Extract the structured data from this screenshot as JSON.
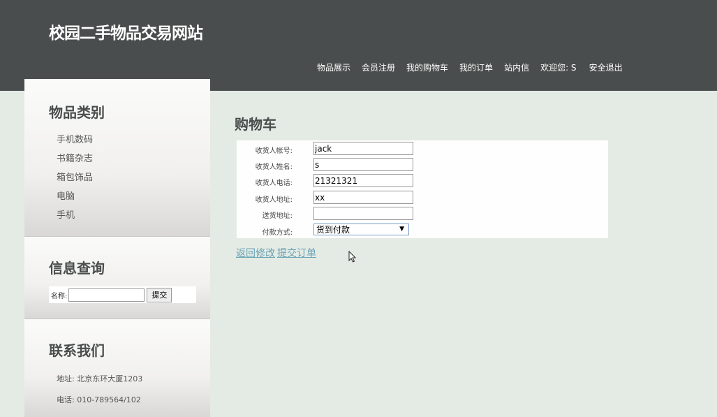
{
  "header": {
    "title": "校园二手物品交易网站",
    "nav": [
      "物品展示",
      "会员注册",
      "我的购物车",
      "我的订单",
      "站内信"
    ],
    "welcome": "欢迎您: S",
    "logout": "安全退出"
  },
  "sidebar": {
    "categories": {
      "heading": "物品类别",
      "items": [
        "手机数码",
        "书籍杂志",
        "箱包饰品",
        "电脑",
        "手机"
      ]
    },
    "search": {
      "heading": "信息查询",
      "label": "名称:",
      "value": "",
      "button": "提交"
    },
    "contact": {
      "heading": "联系我们",
      "address": "地址: 北京东环大厦1203",
      "phone": "电话: 010-789564/102"
    }
  },
  "main": {
    "title": "购物车",
    "form": {
      "account_label": "收货人帐号:",
      "account_value": "jack",
      "name_label": "收货人姓名:",
      "name_value": "s",
      "phone_label": "收货人电话:",
      "phone_value": "21321321",
      "address_label": "收货人地址:",
      "address_value": "xx",
      "delivery_label": "送货地址:",
      "delivery_value": "",
      "payment_label": "付款方式:",
      "payment_value": "货到付款"
    },
    "links": {
      "back": "返回修改",
      "submit": "提交订单"
    }
  }
}
